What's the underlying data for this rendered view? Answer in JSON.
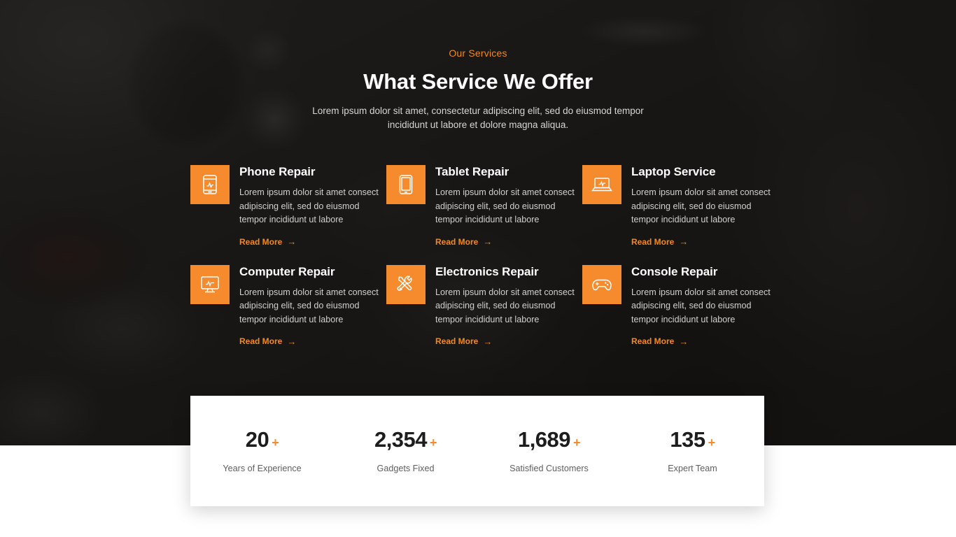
{
  "hero": {
    "eyebrow": "Our Services",
    "title": "What Service We Offer",
    "subtitle": "Lorem ipsum dolor sit amet, consectetur adipiscing elit, sed do eiusmod tempor incididunt ut labore et dolore magna aliqua."
  },
  "colors": {
    "accent": "#f58b2c",
    "accent_text": "#f08a1e",
    "hero_bg": "#1c1b1a",
    "card_bg": "#ffffff",
    "title_text": "#ffffff",
    "body_text": "#d2d0ce",
    "stat_value": "#1d1d1d",
    "stat_label": "#5f5f5f"
  },
  "services": [
    {
      "icon": "smartphone-icon",
      "title": "Phone Repair",
      "text": "Lorem ipsum dolor sit amet consect adipiscing elit, sed do eiusmod tempor incididunt ut labore",
      "link_label": "Read More",
      "link_arrow": "→"
    },
    {
      "icon": "tablet-icon",
      "title": "Tablet Repair",
      "text": "Lorem ipsum dolor sit amet consect adipiscing elit, sed do eiusmod tempor incididunt ut labore",
      "link_label": "Read More",
      "link_arrow": "→"
    },
    {
      "icon": "laptop-icon",
      "title": "Laptop Service",
      "text": "Lorem ipsum dolor sit amet consect adipiscing elit, sed do eiusmod tempor incididunt ut labore",
      "link_label": "Read More",
      "link_arrow": "→"
    },
    {
      "icon": "desktop-monitor-icon",
      "title": "Computer Repair",
      "text": "Lorem ipsum dolor sit amet consect adipiscing elit, sed do eiusmod tempor incididunt ut labore",
      "link_label": "Read More",
      "link_arrow": "→"
    },
    {
      "icon": "screwdriver-wrench-icon",
      "title": "Electronics Repair",
      "text": "Lorem ipsum dolor sit amet consect adipiscing elit, sed do eiusmod tempor incididunt ut labore",
      "link_label": "Read More",
      "link_arrow": "→"
    },
    {
      "icon": "gamepad-icon",
      "title": "Console Repair",
      "text": "Lorem ipsum dolor sit amet consect adipiscing elit, sed do eiusmod tempor incididunt ut labore",
      "link_label": "Read More",
      "link_arrow": "→"
    }
  ],
  "stats": [
    {
      "value": "20",
      "suffix": "+",
      "label": "Years of Experience"
    },
    {
      "value": "2,354",
      "suffix": "+",
      "label": "Gadgets Fixed"
    },
    {
      "value": "1,689",
      "suffix": "+",
      "label": "Satisfied Customers"
    },
    {
      "value": "135",
      "suffix": "+",
      "label": "Expert Team"
    }
  ]
}
